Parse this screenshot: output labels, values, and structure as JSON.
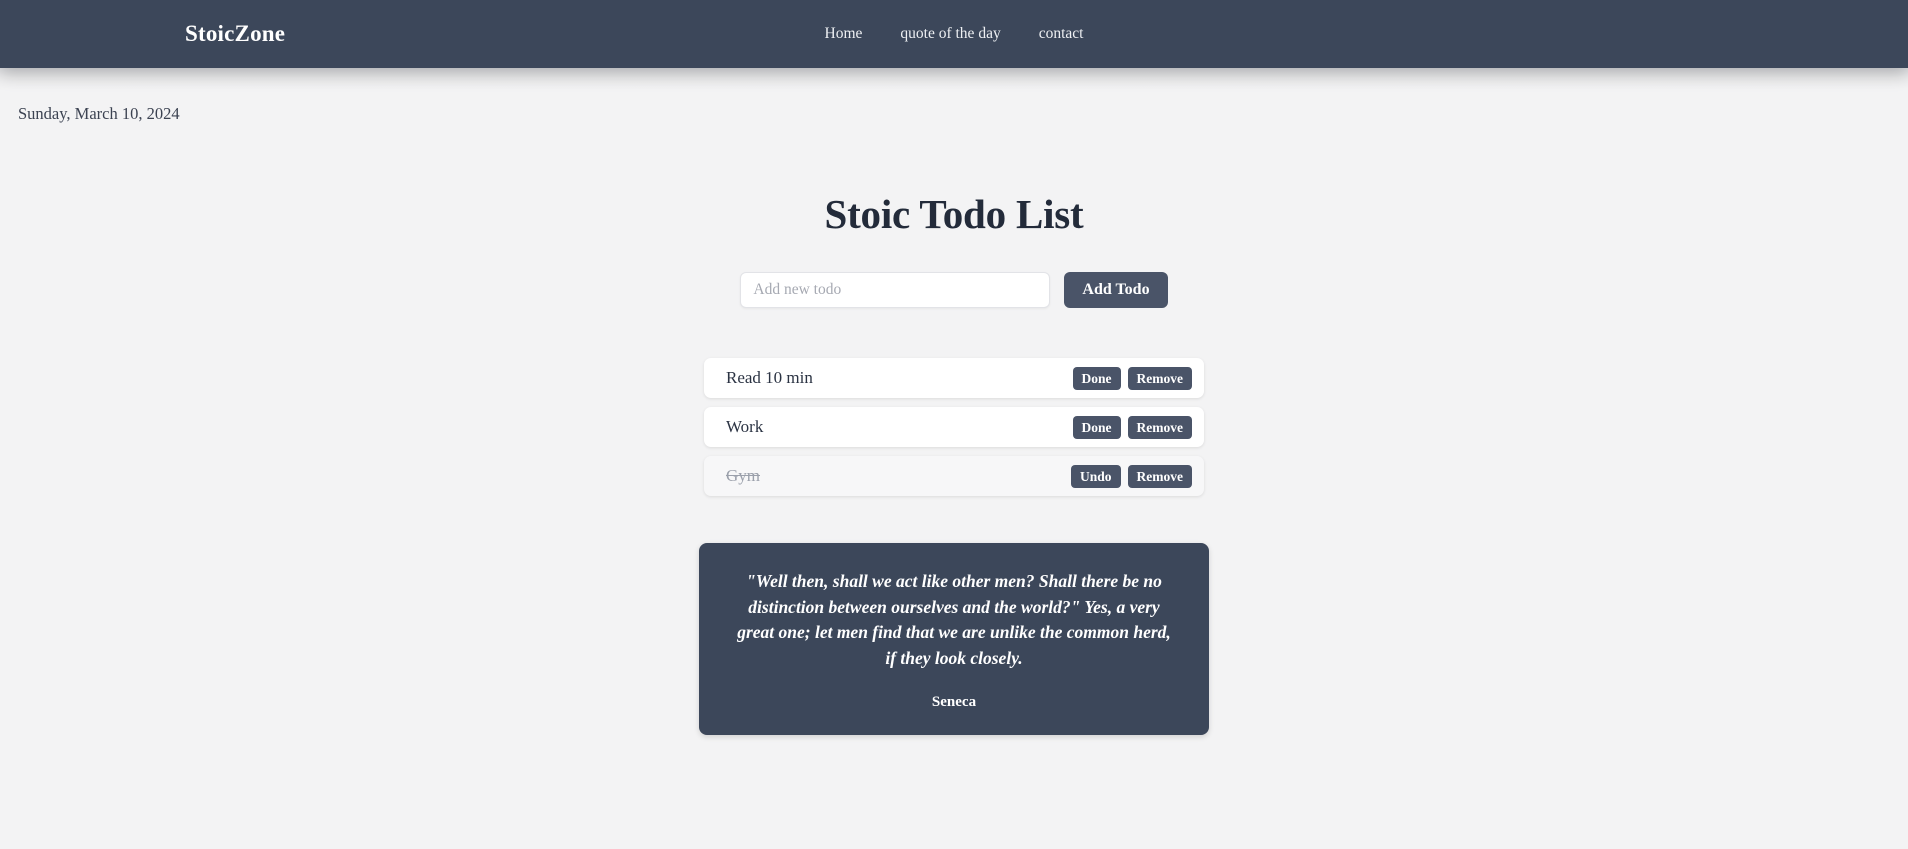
{
  "header": {
    "brand": "StoicZone",
    "nav": [
      {
        "label": "Home"
      },
      {
        "label": "quote of the day"
      },
      {
        "label": "contact"
      }
    ]
  },
  "date_line": "Sunday, March 10, 2024",
  "main": {
    "title": "Stoic Todo List",
    "form": {
      "input_value": "",
      "input_placeholder": "Add new todo",
      "submit_label": "Add Todo"
    },
    "todos": [
      {
        "text": "Read 10 min",
        "completed": false,
        "toggle_label": "Done",
        "remove_label": "Remove"
      },
      {
        "text": "Work",
        "completed": false,
        "toggle_label": "Done",
        "remove_label": "Remove"
      },
      {
        "text": "Gym",
        "completed": true,
        "toggle_label": "Undo",
        "remove_label": "Remove"
      }
    ]
  },
  "quote": {
    "text": "\"Well then, shall we act like other men? Shall there be no distinction between ourselves and the world?\" Yes, a very great one; let men find that we are unlike the common herd, if they look closely.",
    "author": "Seneca"
  },
  "colors": {
    "header_bg": "#3c475a",
    "page_bg": "#f3f3f4",
    "button_bg": "#4a5468",
    "title_text": "#232b3a",
    "done_text": "#9ba0ab"
  }
}
